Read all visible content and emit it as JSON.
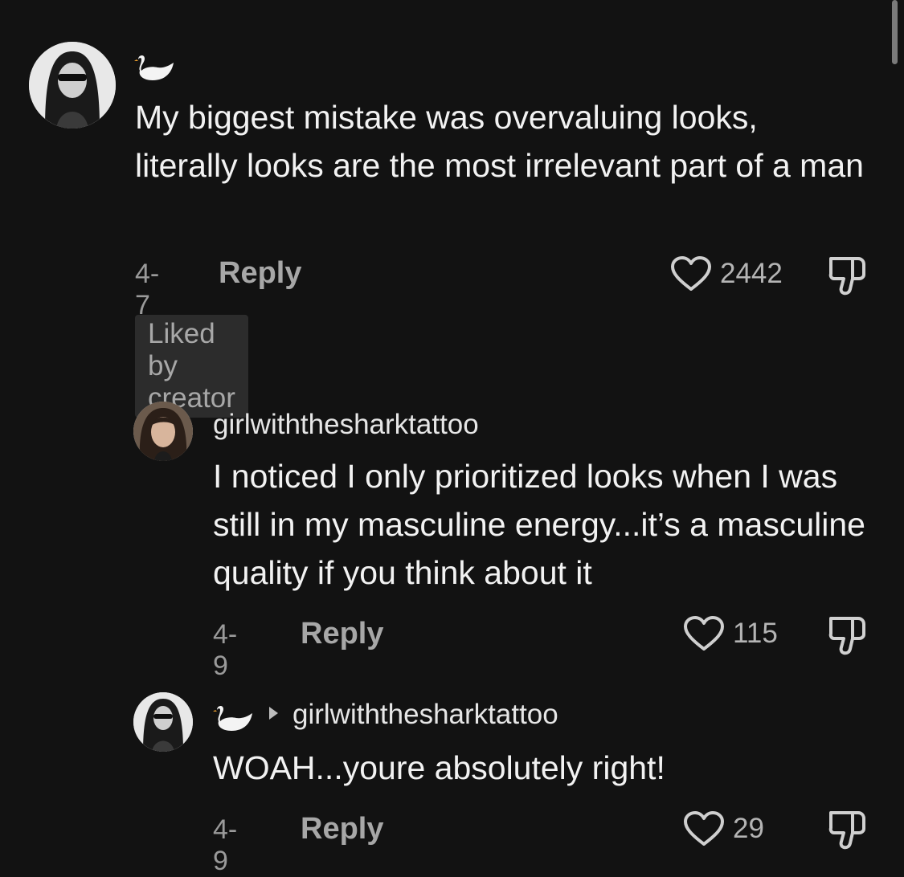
{
  "comments": [
    {
      "username_icon": "swan-icon",
      "text": "My biggest mistake was overvaluing looks, literally looks are the most irrelevant part of a man",
      "date": "4-7",
      "reply_label": "Reply",
      "likes": "2442",
      "badge": "Liked by creator"
    },
    {
      "username": "girlwiththesharktattoo",
      "text": "I noticed I only prioritized looks when I was still in my masculine energy...it’s a masculine quality if you think about it",
      "date": "4-9",
      "reply_label": "Reply",
      "likes": "115"
    },
    {
      "username_icon": "swan-icon",
      "replying_to": "girlwiththesharktattoo",
      "text": "WOAH...youre absolutely right!",
      "date": "4-9",
      "reply_label": "Reply",
      "likes": "29"
    }
  ],
  "colors": {
    "background": "#121212",
    "text": "#f2f2f2",
    "muted": "#9a9a9a"
  }
}
